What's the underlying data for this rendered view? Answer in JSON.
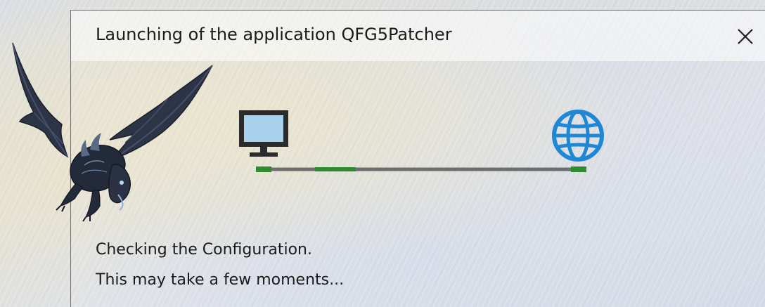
{
  "window": {
    "title": "Launching of the application QFG5Patcher",
    "close_icon": "close-icon"
  },
  "illustration": {
    "logo_icon": "dragon-icon",
    "source_icon": "monitor-icon",
    "destination_icon": "globe-icon",
    "connection_progress": "partial",
    "colors": {
      "monitor_screen": "#a8d2ec",
      "monitor_frame": "#2b2b2b",
      "globe": "#1e88d6",
      "link_line": "#6e6e6e",
      "link_active": "#2e8b2e"
    }
  },
  "status": {
    "line1": "Checking the Configuration.",
    "line2": "This may take a few moments..."
  }
}
